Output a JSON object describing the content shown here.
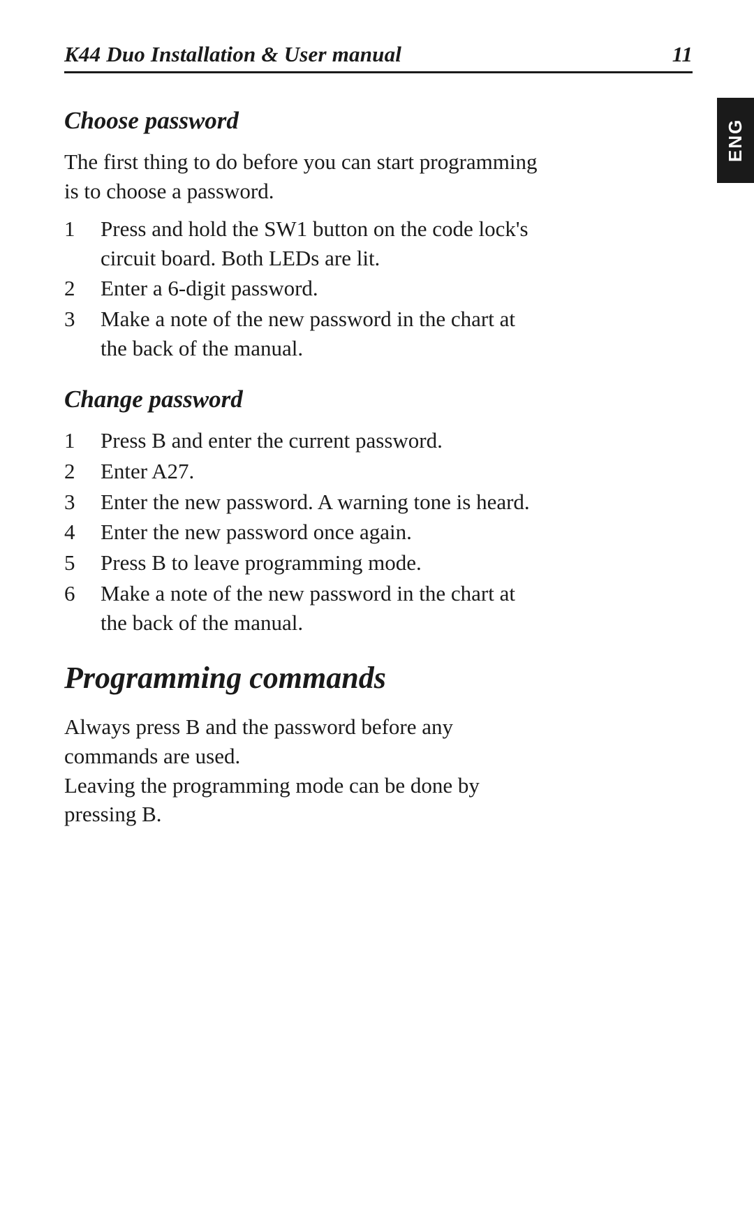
{
  "header": {
    "title": "K44 Duo Installation & User manual",
    "page_number": "11"
  },
  "language_tab": "ENG",
  "sections": [
    {
      "heading": "Choose password",
      "intro": "The first thing to do before you can start programming is to choose a password.",
      "steps": [
        "Press and hold the SW1 button on the code lock's circuit board. Both LEDs are lit.",
        "Enter a 6-digit password.",
        "Make a note of the new password in the chart at the back of the manual."
      ]
    },
    {
      "heading": "Change password",
      "intro": null,
      "steps": [
        "Press B and enter the current password.",
        "Enter A27.",
        "Enter the new password. A warning tone is heard.",
        "Enter the new password once again.",
        "Press B to leave programming mode.",
        "Make a note of the new password in the chart at the back of the manual."
      ]
    }
  ],
  "main_section": {
    "heading": "Programming commands",
    "paragraphs": [
      "Always press B and the password before any commands are used.",
      "Leaving the programming mode can be done by pressing B."
    ]
  }
}
